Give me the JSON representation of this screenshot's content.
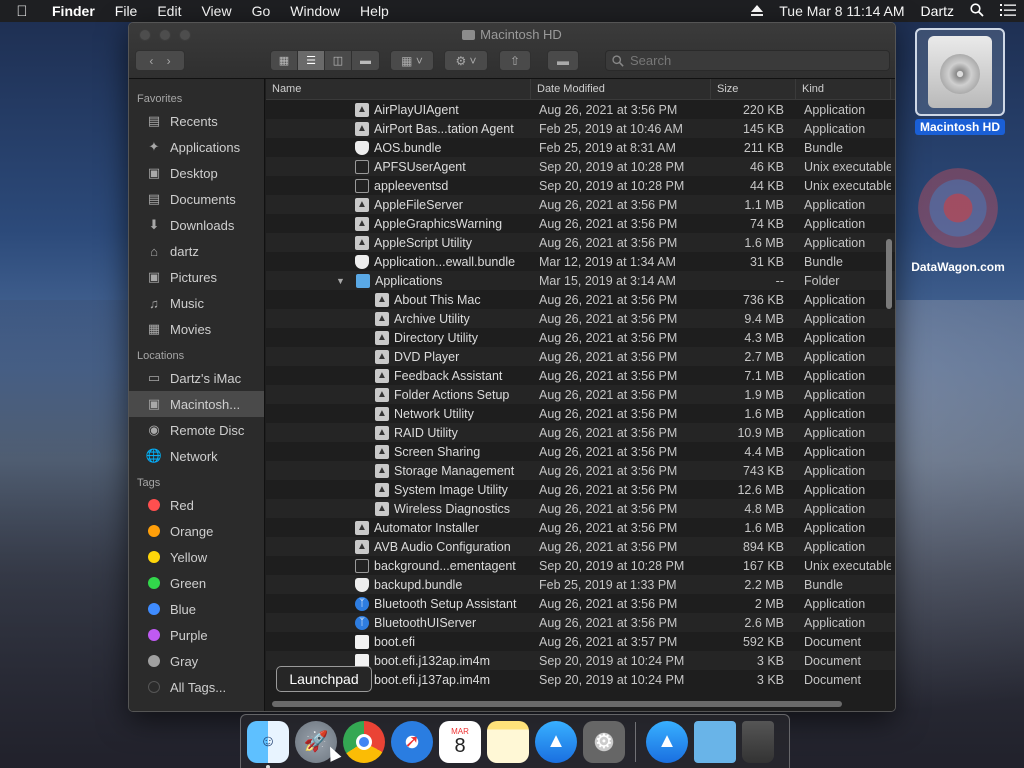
{
  "menubar": {
    "items": [
      "Finder",
      "File",
      "Edit",
      "View",
      "Go",
      "Window",
      "Help"
    ],
    "clock": "Tue Mar 8  11:14 AM",
    "user": "Dartz"
  },
  "window": {
    "title": "Macintosh HD",
    "search_placeholder": "Search"
  },
  "sidebar": {
    "favorites_label": "Favorites",
    "favorites": [
      "Recents",
      "Applications",
      "Desktop",
      "Documents",
      "Downloads",
      "dartz",
      "Pictures",
      "Music",
      "Movies"
    ],
    "locations_label": "Locations",
    "locations": [
      "Dartz's iMac",
      "Macintosh...",
      "Remote Disc",
      "Network"
    ],
    "tags_label": "Tags",
    "tags": [
      {
        "name": "Red",
        "color": "#ff4f4f"
      },
      {
        "name": "Orange",
        "color": "#ff9f0a"
      },
      {
        "name": "Yellow",
        "color": "#ffd60a"
      },
      {
        "name": "Green",
        "color": "#32d74b"
      },
      {
        "name": "Blue",
        "color": "#3f8cff"
      },
      {
        "name": "Purple",
        "color": "#bf5af2"
      },
      {
        "name": "Gray",
        "color": "#a0a0a0"
      },
      {
        "name": "All Tags...",
        "color": "#555555"
      }
    ]
  },
  "columns": {
    "name": "Name",
    "date": "Date Modified",
    "size": "Size",
    "kind": "Kind"
  },
  "rows": [
    {
      "name": "AirPlayUIAgent",
      "date": "Aug 26, 2021 at 3:56 PM",
      "size": "220 KB",
      "kind": "Application",
      "icon": "app",
      "indent": 0
    },
    {
      "name": "AirPort Bas...tation Agent",
      "date": "Feb 25, 2019 at 10:46 AM",
      "size": "145 KB",
      "kind": "Application",
      "icon": "app",
      "indent": 0
    },
    {
      "name": "AOS.bundle",
      "date": "Feb 25, 2019 at 8:31 AM",
      "size": "211 KB",
      "kind": "Bundle",
      "icon": "bundle",
      "indent": 0
    },
    {
      "name": "APFSUserAgent",
      "date": "Sep 20, 2019 at 10:28 PM",
      "size": "46 KB",
      "kind": "Unix executable",
      "icon": "exec",
      "indent": 0
    },
    {
      "name": "appleeventsd",
      "date": "Sep 20, 2019 at 10:28 PM",
      "size": "44 KB",
      "kind": "Unix executable",
      "icon": "exec",
      "indent": 0
    },
    {
      "name": "AppleFileServer",
      "date": "Aug 26, 2021 at 3:56 PM",
      "size": "1.1 MB",
      "kind": "Application",
      "icon": "app",
      "indent": 0
    },
    {
      "name": "AppleGraphicsWarning",
      "date": "Aug 26, 2021 at 3:56 PM",
      "size": "74 KB",
      "kind": "Application",
      "icon": "app",
      "indent": 0
    },
    {
      "name": "AppleScript Utility",
      "date": "Aug 26, 2021 at 3:56 PM",
      "size": "1.6 MB",
      "kind": "Application",
      "icon": "app",
      "indent": 0
    },
    {
      "name": "Application...ewall.bundle",
      "date": "Mar 12, 2019 at 1:34 AM",
      "size": "31 KB",
      "kind": "Bundle",
      "icon": "bundle",
      "indent": 0
    },
    {
      "name": "Applications",
      "date": "Mar 15, 2019 at 3:14 AM",
      "size": "--",
      "kind": "Folder",
      "icon": "folder",
      "indent": 0,
      "expanded": true
    },
    {
      "name": "About This Mac",
      "date": "Aug 26, 2021 at 3:56 PM",
      "size": "736 KB",
      "kind": "Application",
      "icon": "app",
      "indent": 1
    },
    {
      "name": "Archive Utility",
      "date": "Aug 26, 2021 at 3:56 PM",
      "size": "9.4 MB",
      "kind": "Application",
      "icon": "app",
      "indent": 1
    },
    {
      "name": "Directory Utility",
      "date": "Aug 26, 2021 at 3:56 PM",
      "size": "4.3 MB",
      "kind": "Application",
      "icon": "app",
      "indent": 1
    },
    {
      "name": "DVD Player",
      "date": "Aug 26, 2021 at 3:56 PM",
      "size": "2.7 MB",
      "kind": "Application",
      "icon": "app",
      "indent": 1
    },
    {
      "name": "Feedback Assistant",
      "date": "Aug 26, 2021 at 3:56 PM",
      "size": "7.1 MB",
      "kind": "Application",
      "icon": "app",
      "indent": 1
    },
    {
      "name": "Folder Actions Setup",
      "date": "Aug 26, 2021 at 3:56 PM",
      "size": "1.9 MB",
      "kind": "Application",
      "icon": "app",
      "indent": 1
    },
    {
      "name": "Network Utility",
      "date": "Aug 26, 2021 at 3:56 PM",
      "size": "1.6 MB",
      "kind": "Application",
      "icon": "app",
      "indent": 1
    },
    {
      "name": "RAID Utility",
      "date": "Aug 26, 2021 at 3:56 PM",
      "size": "10.9 MB",
      "kind": "Application",
      "icon": "app",
      "indent": 1
    },
    {
      "name": "Screen Sharing",
      "date": "Aug 26, 2021 at 3:56 PM",
      "size": "4.4 MB",
      "kind": "Application",
      "icon": "app",
      "indent": 1
    },
    {
      "name": "Storage Management",
      "date": "Aug 26, 2021 at 3:56 PM",
      "size": "743 KB",
      "kind": "Application",
      "icon": "app",
      "indent": 1
    },
    {
      "name": "System Image Utility",
      "date": "Aug 26, 2021 at 3:56 PM",
      "size": "12.6 MB",
      "kind": "Application",
      "icon": "app",
      "indent": 1
    },
    {
      "name": "Wireless Diagnostics",
      "date": "Aug 26, 2021 at 3:56 PM",
      "size": "4.8 MB",
      "kind": "Application",
      "icon": "app",
      "indent": 1
    },
    {
      "name": "Automator Installer",
      "date": "Aug 26, 2021 at 3:56 PM",
      "size": "1.6 MB",
      "kind": "Application",
      "icon": "app",
      "indent": 0
    },
    {
      "name": "AVB Audio Configuration",
      "date": "Aug 26, 2021 at 3:56 PM",
      "size": "894 KB",
      "kind": "Application",
      "icon": "app",
      "indent": 0
    },
    {
      "name": "background...ementagent",
      "date": "Sep 20, 2019 at 10:28 PM",
      "size": "167 KB",
      "kind": "Unix executable",
      "icon": "exec",
      "indent": 0
    },
    {
      "name": "backupd.bundle",
      "date": "Feb 25, 2019 at 1:33 PM",
      "size": "2.2 MB",
      "kind": "Bundle",
      "icon": "bundle",
      "indent": 0
    },
    {
      "name": "Bluetooth Setup Assistant",
      "date": "Aug 26, 2021 at 3:56 PM",
      "size": "2 MB",
      "kind": "Application",
      "icon": "bt",
      "indent": 0
    },
    {
      "name": "BluetoothUIServer",
      "date": "Aug 26, 2021 at 3:56 PM",
      "size": "2.6 MB",
      "kind": "Application",
      "icon": "bt",
      "indent": 0
    },
    {
      "name": "boot.efi",
      "date": "Aug 26, 2021 at 3:57 PM",
      "size": "592 KB",
      "kind": "Document",
      "icon": "doc",
      "indent": 0
    },
    {
      "name": "boot.efi.j132ap.im4m",
      "date": "Sep 20, 2019 at 10:24 PM",
      "size": "3 KB",
      "kind": "Document",
      "icon": "doc",
      "indent": 0
    },
    {
      "name": "boot.efi.j137ap.im4m",
      "date": "Sep 20, 2019 at 10:24 PM",
      "size": "3 KB",
      "kind": "Document",
      "icon": "doc",
      "indent": 0
    }
  ],
  "desktop": {
    "hd_label": "Macintosh HD",
    "dw_label": "DataWagon.com"
  },
  "tooltip": "Launchpad",
  "dock_apps": [
    "finder-icon",
    "launchpad-icon",
    "chrome-icon",
    "safari-icon",
    "calendar-icon",
    "notes-icon",
    "app-store-icon",
    "system-preferences-icon",
    "applications-stack-icon",
    "folder-stack-icon",
    "trash-icon"
  ],
  "dock_calendar": {
    "month": "MAR",
    "day": "8"
  }
}
